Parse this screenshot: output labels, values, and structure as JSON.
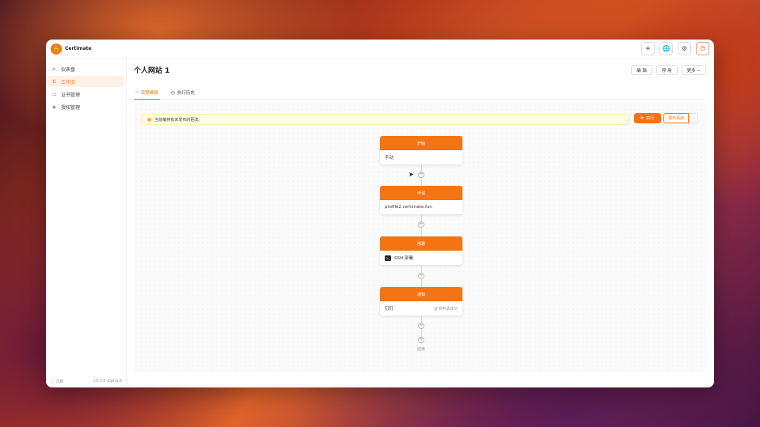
{
  "app": {
    "name": "Certimate",
    "logo_glyph": "🔒"
  },
  "topbar": {
    "theme_icon": "☀",
    "globe_icon": "🌐",
    "settings_icon": "⚙",
    "logout_icon": "⏻"
  },
  "sidebar": {
    "items": [
      {
        "label": "仪表盘",
        "icon": "⌂"
      },
      {
        "label": "工作流",
        "icon": "⇅"
      },
      {
        "label": "证书管理",
        "icon": "▭"
      },
      {
        "label": "授权管理",
        "icon": "◈"
      }
    ],
    "footer": {
      "docs": "文档",
      "docs_icon": "▢",
      "version": "v0.3.0-alpha.8"
    }
  },
  "page": {
    "title": "个人网站 1",
    "buttons": {
      "edit": "编 辑",
      "disable": "停 用",
      "more": "更多",
      "more_icon": "⌄"
    },
    "tabs": [
      {
        "label": "流程编排",
        "icon": "⑃"
      },
      {
        "label": "执行历史",
        "icon": "◷"
      }
    ]
  },
  "canvas": {
    "alert": {
      "icon": "●",
      "text": "当前编排有未发布的更改。"
    },
    "run_button": {
      "icon": "▶",
      "label": "执行"
    },
    "publish_button": {
      "label": "发布更改",
      "more": "···"
    },
    "nodes": [
      {
        "title": "开始",
        "body": "手动",
        "sub": ""
      },
      {
        "title": "申请",
        "body": "profile2.certimate.fun",
        "sub": ""
      },
      {
        "title": "部署",
        "body": "SSH 部署",
        "sub": "",
        "icon": ">_"
      },
      {
        "title": "通知",
        "body": "钉钉",
        "sub": "证书申请成功"
      }
    ],
    "plus_glyph": "+",
    "end_label": "结束"
  },
  "colors": {
    "accent": "#f47414",
    "warning": "#f5a623"
  }
}
